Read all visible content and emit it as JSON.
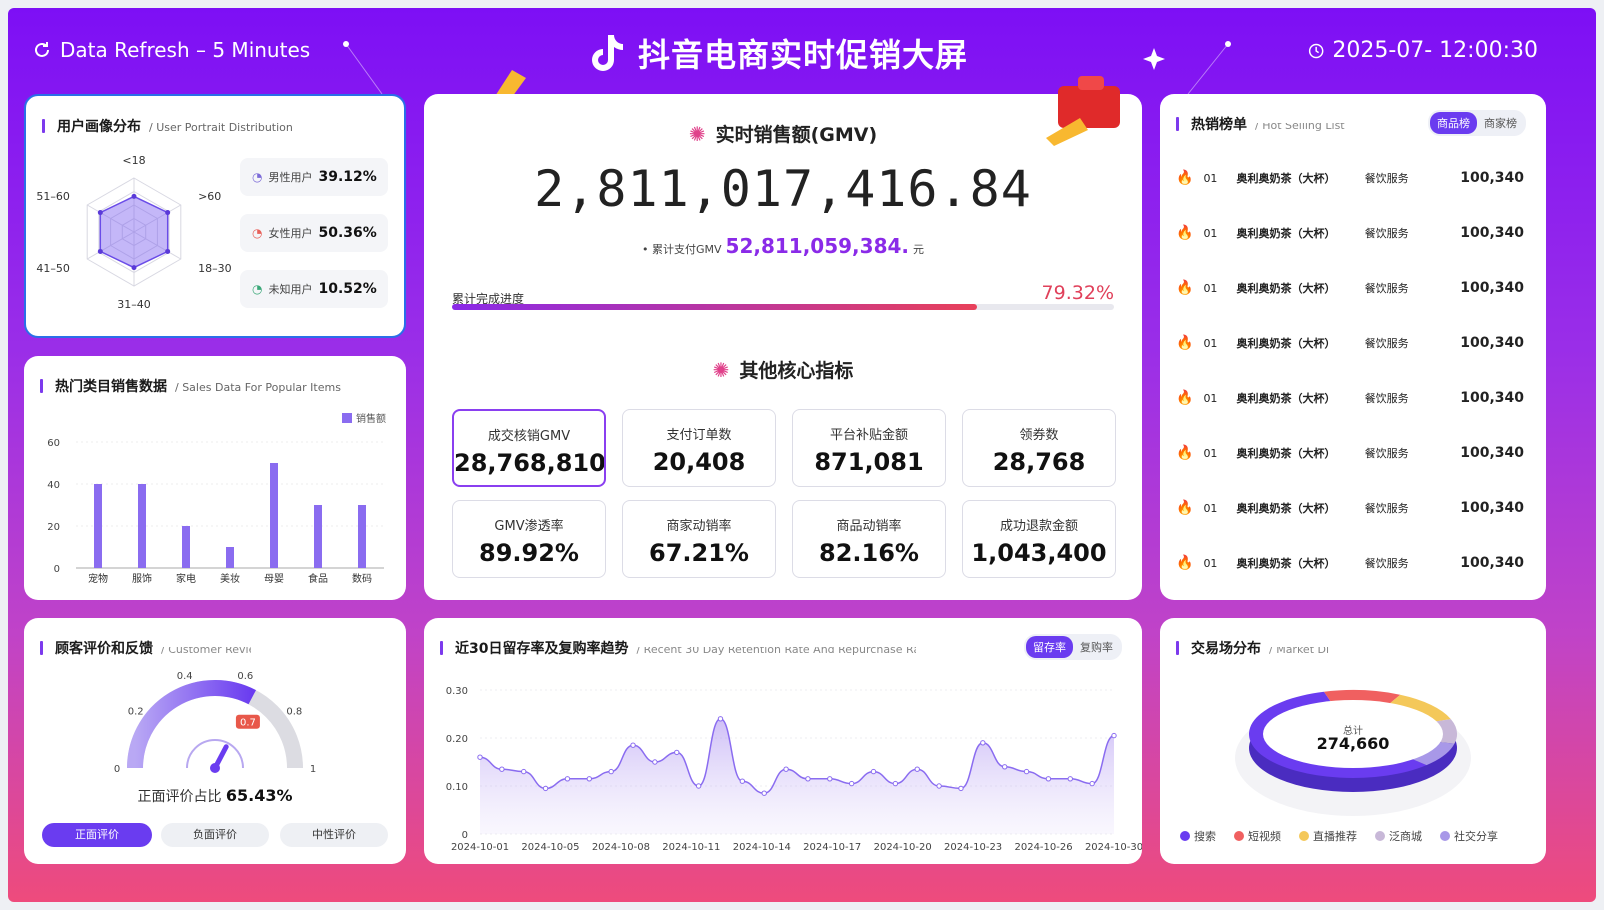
{
  "header": {
    "refresh": "Data Refresh – 5 Minutes",
    "title": "抖音电商实时促销大屏",
    "time": "2025-07- 12:00:30"
  },
  "portrait": {
    "title": "用户画像分布",
    "subtitle": "/ User Portrait Distribution",
    "axes": [
      "<18",
      ">60",
      "18–30",
      "31–40",
      "41–50",
      "51–60"
    ],
    "radar_values": [
      0.66,
      0.72,
      0.72,
      0.66,
      0.72,
      0.72
    ],
    "stats": [
      {
        "label": "男性用户",
        "value": "39.12%"
      },
      {
        "label": "女性用户",
        "value": "50.36%"
      },
      {
        "label": "未知用户",
        "value": "10.52%"
      }
    ]
  },
  "popular": {
    "title": "热门类目销售数据",
    "subtitle": "/ Sales Data For Popular Items",
    "legend": "销售额",
    "chart_data": {
      "type": "bar",
      "categories": [
        "宠物",
        "服饰",
        "家电",
        "美妆",
        "母婴",
        "食品",
        "数码"
      ],
      "series": [
        {
          "name": "销售额",
          "values": [
            40,
            40,
            20,
            10,
            50,
            30,
            30
          ]
        }
      ],
      "yticks": [
        "0",
        "20",
        "40",
        "60"
      ],
      "ylim": [
        0,
        60
      ]
    }
  },
  "gmv": {
    "title": "实时销售额(GMV)",
    "value": "2,811,017,416.84",
    "cum_label": "累计支付GMV",
    "cum_value": "52,811,059,384.",
    "unit": "元",
    "progress_label": "累计完成进度",
    "progress_pct": "79.32%",
    "progress": 0.7932,
    "other_title": "其他核心指标",
    "kpis": [
      {
        "label": "成交核销GMV",
        "value": "28,768,810"
      },
      {
        "label": "支付订单数",
        "value": "20,408"
      },
      {
        "label": "平台补贴金额",
        "value": "871,081"
      },
      {
        "label": "领券数",
        "value": "28,768"
      },
      {
        "label": "GMV渗透率",
        "value": "89.92%"
      },
      {
        "label": "商家动销率",
        "value": "67.21%"
      },
      {
        "label": "商品动销率",
        "value": "82.16%"
      },
      {
        "label": "成功退款金额",
        "value": "1,043,400"
      }
    ]
  },
  "hot": {
    "title": "热销榜单",
    "tabs": [
      "商品榜",
      "商家榜"
    ],
    "rows": [
      {
        "no": "01",
        "name": "奥利奥奶茶（大杯）",
        "cat": "餐饮服务",
        "value": "100,340"
      },
      {
        "no": "01",
        "name": "奥利奥奶茶（大杯）",
        "cat": "餐饮服务",
        "value": "100,340"
      },
      {
        "no": "01",
        "name": "奥利奥奶茶（大杯）",
        "cat": "餐饮服务",
        "value": "100,340"
      },
      {
        "no": "01",
        "name": "奥利奥奶茶（大杯）",
        "cat": "餐饮服务",
        "value": "100,340"
      },
      {
        "no": "01",
        "name": "奥利奥奶茶（大杯）",
        "cat": "餐饮服务",
        "value": "100,340"
      },
      {
        "no": "01",
        "name": "奥利奥奶茶（大杯）",
        "cat": "餐饮服务",
        "value": "100,340"
      },
      {
        "no": "01",
        "name": "奥利奥奶茶（大杯）",
        "cat": "餐饮服务",
        "value": "100,340"
      },
      {
        "no": "01",
        "name": "奥利奥奶茶（大杯）",
        "cat": "餐饮服务",
        "value": "100,340"
      }
    ]
  },
  "feedback": {
    "title": "顾客评价和反馈",
    "gauge_ticks": [
      "0",
      "0.2",
      "0.4",
      "0.6",
      "0.8",
      "1"
    ],
    "gauge_marker": "0.7",
    "gauge_value": 0.6543,
    "caption": "正面评价占比",
    "caption_value": "65.43%",
    "buttons": [
      "正面评价",
      "负面评价",
      "中性评价"
    ]
  },
  "retention": {
    "title": "近30日留存率及复购率趋势",
    "tabs": [
      "留存率",
      "复购率"
    ],
    "chart_data": {
      "type": "area",
      "yticks": [
        "0",
        "0.10",
        "0.20",
        "0.30"
      ],
      "ylim": [
        0,
        0.3
      ],
      "xticks": [
        "2024-10-01",
        "2024-10-05",
        "2024-10-08",
        "2024-10-11",
        "2024-10-14",
        "2024-10-17",
        "2024-10-20",
        "2024-10-23",
        "2024-10-26",
        "2024-10-30"
      ],
      "series": [
        {
          "name": "留存率",
          "values": [
            0.16,
            0.135,
            0.13,
            0.095,
            0.115,
            0.115,
            0.13,
            0.185,
            0.15,
            0.17,
            0.1,
            0.24,
            0.11,
            0.085,
            0.135,
            0.115,
            0.115,
            0.105,
            0.13,
            0.105,
            0.135,
            0.1,
            0.095,
            0.19,
            0.14,
            0.13,
            0.115,
            0.115,
            0.105,
            0.205
          ]
        }
      ]
    }
  },
  "market": {
    "title": "交易场分布",
    "total_label": "总计",
    "total": "274,660",
    "chart_data": {
      "type": "pie",
      "slices": [
        {
          "name": "搜索",
          "value": 58,
          "color": "#6a3cf0"
        },
        {
          "name": "短视频",
          "value": 12,
          "color": "#f06060"
        },
        {
          "name": "直播推荐",
          "value": 12,
          "color": "#f4c85a"
        },
        {
          "name": "泛商城",
          "value": 9,
          "color": "#c8b8d8"
        },
        {
          "name": "社交分享",
          "value": 9,
          "color": "#a898e8"
        }
      ]
    }
  }
}
